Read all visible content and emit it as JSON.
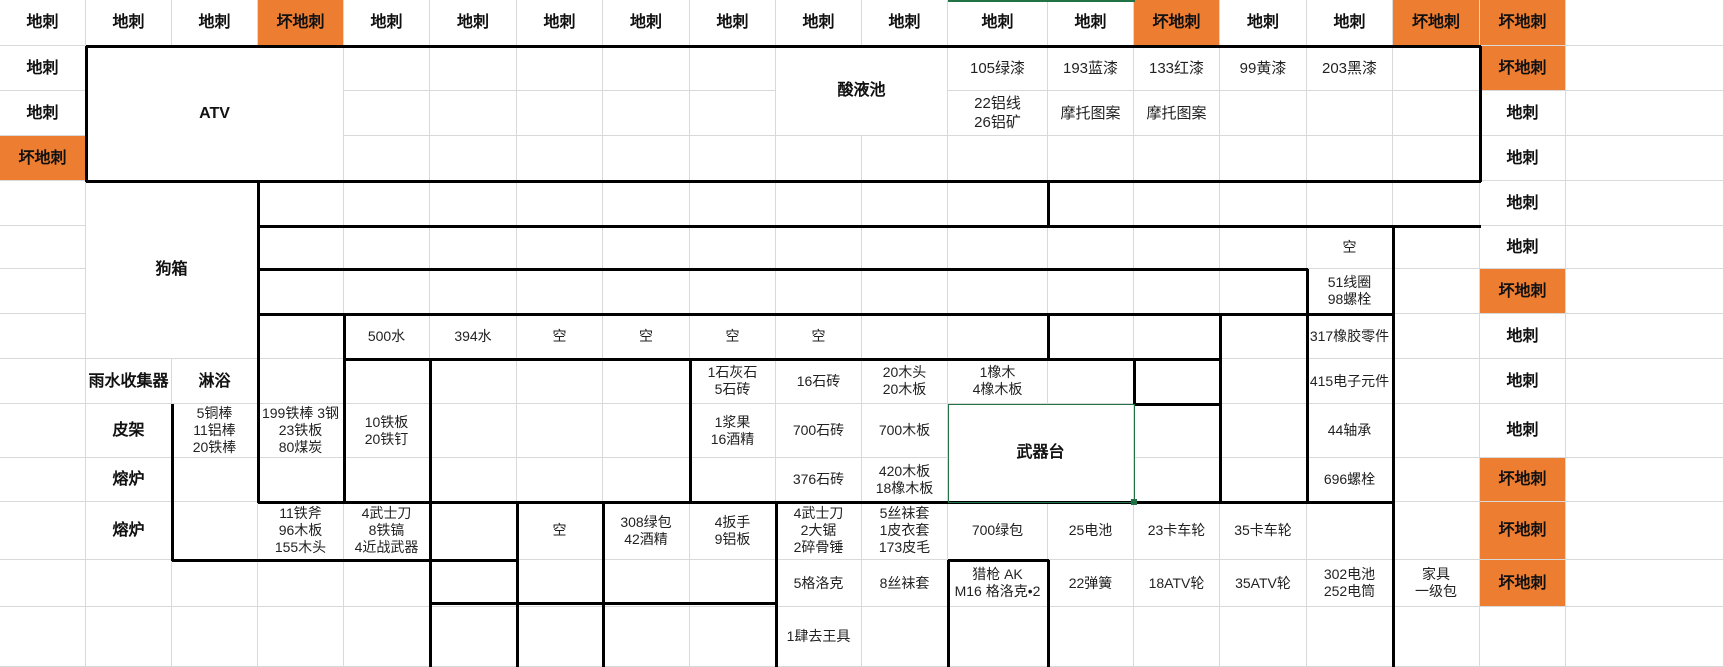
{
  "sheet": {
    "row1": [
      "地刺",
      "地刺",
      "地刺",
      "坏地刺",
      "地刺",
      "地刺",
      "地刺",
      "地刺",
      "地刺",
      "地刺",
      "地刺",
      "地刺",
      "地刺",
      "坏地刺",
      "地刺",
      "地刺",
      "坏地刺",
      "坏地刺"
    ],
    "left_col": [
      "地刺",
      "地刺",
      "坏地刺"
    ],
    "right_col": [
      "坏地刺",
      "地刺",
      "地刺",
      "地刺",
      "地刺",
      "坏地刺",
      "地刺",
      "地刺",
      "地刺",
      "坏地刺",
      "坏地刺",
      "坏地刺"
    ],
    "areas": {
      "atv": "ATV",
      "acid_pool": "酸液池",
      "dog_box": "狗箱",
      "weapon_bench": "武器台"
    },
    "paints": [
      "105绿漆",
      "193蓝漆",
      "133红漆",
      "99黄漆",
      "203黑漆"
    ],
    "row3_items": [
      "22铝线\n26铝矿",
      "摩托图案",
      "摩托图案"
    ],
    "right_stack": [
      "空",
      "51线圈\n98螺栓",
      "317橡胶零件",
      "415电子元件",
      "44轴承",
      "696螺栓",
      "302电池\n252电筒"
    ],
    "water_row": [
      "500水",
      "394水",
      "空",
      "空",
      "空",
      "空"
    ],
    "labels": {
      "rain_collector": "雨水收集器",
      "shower": "淋浴",
      "hide_rack": "皮架",
      "furnace_1": "熔炉",
      "furnace_2": "熔炉"
    },
    "boxes": {
      "r8": [
        "1石灰石\n5石砖",
        "16石砖",
        "20木头\n20木板",
        "1橡木\n4橡木板"
      ],
      "r9": [
        "5铜棒\n11铝棒\n20铁棒",
        "199铁棒 3钢\n23铁板\n80煤炭",
        "10铁板\n20铁钉",
        "1浆果\n16酒精",
        "700石砖",
        "700木板"
      ],
      "r10": [
        "376石砖",
        "420木板\n18橡木板"
      ],
      "r11": [
        "11铁斧\n96木板\n155木头",
        "4武士刀\n8铁镐\n4近战武器",
        "空",
        "308绿包\n42酒精",
        "4扳手\n9铝板",
        "4武士刀\n2大锯\n2碎骨锤",
        "5丝袜套\n1皮衣套\n173皮毛",
        "700绿包",
        "25电池",
        "23卡车轮",
        "35卡车轮"
      ],
      "r12": [
        "5格洛克",
        "8丝袜套",
        "猎枪 AK\nM16 格洛克•2",
        "22弹簧",
        "18ATV轮",
        "35ATV轮",
        "家具\n一级包"
      ],
      "r13": [
        "1肆去王具"
      ]
    }
  }
}
